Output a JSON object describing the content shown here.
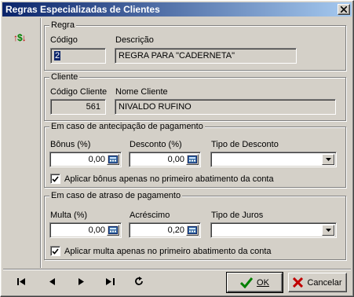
{
  "window": {
    "title": "Regras Especializadas de Clientes"
  },
  "sidebar": {
    "sort_icon": "sort-dollar-icon"
  },
  "regra": {
    "legend": "Regra",
    "codigo_label": "Código",
    "codigo_value": "2",
    "descricao_label": "Descrição",
    "descricao_value": "REGRA PARA \"CADERNETA\""
  },
  "cliente": {
    "legend": "Cliente",
    "codigo_label": "Código Cliente",
    "codigo_value": "561",
    "nome_label": "Nome Cliente",
    "nome_value": "NIVALDO RUFINO"
  },
  "antecipacao": {
    "legend": "Em caso de antecipação de pagamento",
    "bonus_label": "Bônus (%)",
    "bonus_value": "0,00",
    "desconto_label": "Desconto (%)",
    "desconto_value": "0,00",
    "tipo_label": "Tipo de Desconto",
    "tipo_value": "",
    "check_label": "Aplicar bônus apenas no primeiro abatimento da conta",
    "checked": true
  },
  "atraso": {
    "legend": "Em caso de atraso de pagamento",
    "multa_label": "Multa (%)",
    "multa_value": "0,00",
    "acrescimo_label": "Acréscimo",
    "acrescimo_value": "0,20",
    "tipo_label": "Tipo de Juros",
    "tipo_value": "",
    "check_label": "Aplicar multa apenas no primeiro abatimento da conta",
    "checked": true
  },
  "buttons": {
    "ok_label": "OK",
    "cancel_label": "Cancelar"
  },
  "colors": {
    "title_start": "#0a246a",
    "title_end": "#a6caf0",
    "ok_check": "#008000",
    "cancel_x": "#c00000"
  }
}
